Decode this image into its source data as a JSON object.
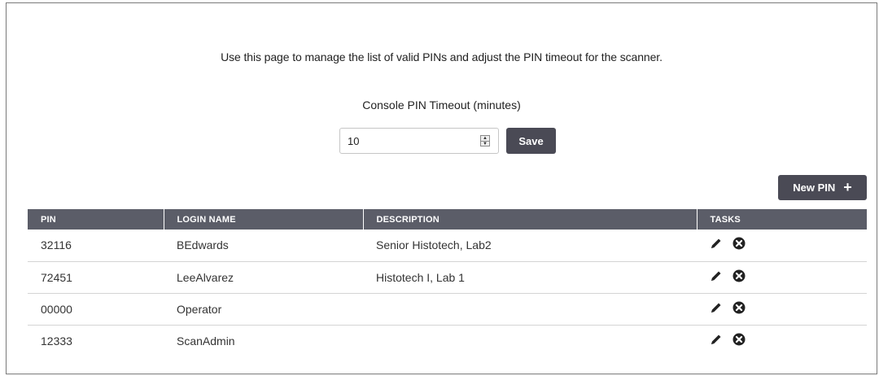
{
  "intro_text": "Use this page to manage the list of valid PINs and adjust the PIN timeout for the scanner.",
  "timeout": {
    "label": "Console PIN Timeout (minutes)",
    "value": "10",
    "save_label": "Save"
  },
  "new_pin_label": "New PIN",
  "table": {
    "columns": [
      "PIN",
      "LOGIN NAME",
      "DESCRIPTION",
      "TASKS"
    ],
    "rows": [
      {
        "pin": "32116",
        "login": "BEdwards",
        "description": "Senior Histotech, Lab2"
      },
      {
        "pin": "72451",
        "login": "LeeAlvarez",
        "description": "Histotech I, Lab 1"
      },
      {
        "pin": "00000",
        "login": "Operator",
        "description": ""
      },
      {
        "pin": "12333",
        "login": "ScanAdmin",
        "description": ""
      }
    ]
  },
  "icons": {
    "edit": "pencil-icon",
    "delete": "close-circle-icon",
    "add": "plus-icon",
    "stepper": "spinner-arrows-icon"
  },
  "colors": {
    "button_bg": "#4a4a55",
    "header_bg": "#5b5d68",
    "text": "#333333"
  }
}
